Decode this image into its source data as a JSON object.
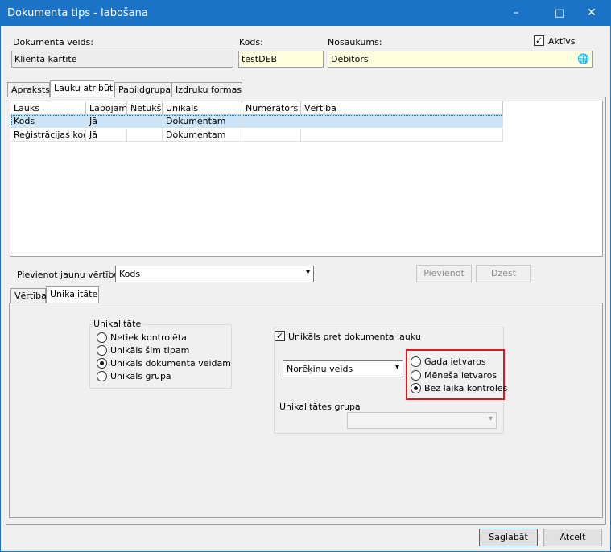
{
  "window": {
    "title": "Dokumenta tips - labošana",
    "controls": {
      "minimize": "–",
      "maximize": "□",
      "close": "✕"
    }
  },
  "header": {
    "doc_type_label": "Dokumenta veids:",
    "doc_type_value": "Klienta kartīte",
    "code_label": "Kods:",
    "code_value": "testDEB",
    "name_label": "Nosaukums:",
    "name_value": "Debitors",
    "active_label": "Aktīvs",
    "active_checked": "✓",
    "globe_icon": "🌐"
  },
  "top_tabs": [
    "Apraksts",
    "Lauku atribūti",
    "Papildgrupas",
    "Izdruku formas"
  ],
  "grid": {
    "columns": [
      "Lauks",
      "Labojams",
      "Netukšs",
      "Unikāls",
      "Numerators",
      "Vērtība"
    ],
    "rows": [
      [
        "Kods",
        "Jā",
        "",
        "Dokumentam",
        "",
        ""
      ],
      [
        "Reģistrācijas kods",
        "Jā",
        "",
        "Dokumentam",
        "",
        ""
      ]
    ]
  },
  "add_value": {
    "label": "Pievienot jaunu vērtību:",
    "selected": "Kods",
    "add_button": "Pievienot",
    "delete_button": "Dzēst"
  },
  "bottom_tabs": [
    "Vērtība",
    "Unikalitāte"
  ],
  "uniqueness": {
    "group_title": "Unikalitāte",
    "options": [
      "Netiek kontrolēta",
      "Unikāls šim tipam",
      "Unikāls dokumenta veidam",
      "Unikāls grupā"
    ],
    "selected_index": 2
  },
  "field_unique": {
    "checkbox_label": "Unikāls pret dokumenta lauku",
    "checkbox_mark": "✓",
    "field_select": "Norēķinu veids",
    "period_options": [
      "Gada ietvaros",
      "Mēneša ietvaros",
      "Bez laika kontroles"
    ],
    "period_selected_index": 2,
    "group_title": "Unikalitātes grupa",
    "group_select": ""
  },
  "footer": {
    "save": "Saglabāt",
    "cancel": "Atcelt"
  },
  "colors": {
    "titlebar": "#1a73c6",
    "highlight": "#e0181e",
    "yellow_field": "#ffffe0",
    "selection": "#cce4f7"
  }
}
